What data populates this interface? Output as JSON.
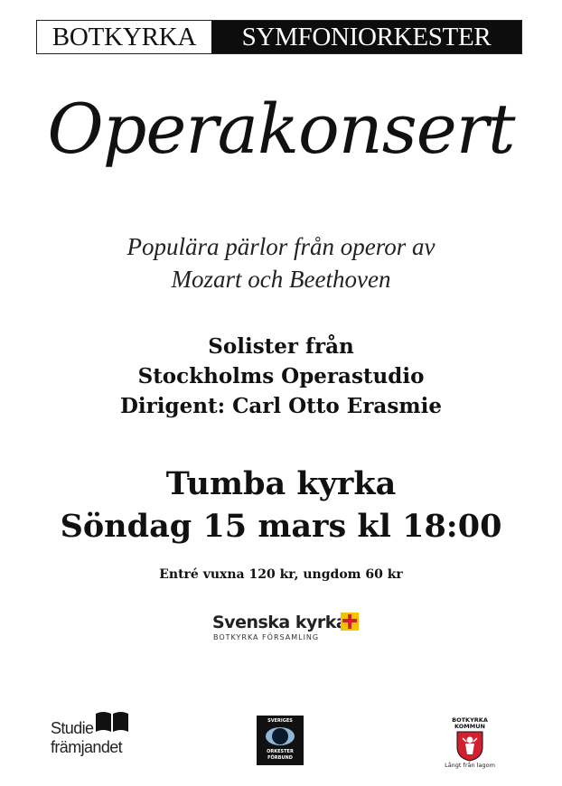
{
  "banner": {
    "left": "BOTKYRKA",
    "right": "SYMFONIORKESTER"
  },
  "title": "Operakonsert",
  "subtitle": [
    "Populära pärlor från operor av",
    "Mozart och Beethoven"
  ],
  "performers": [
    "Solister från",
    "Stockholms Operastudio",
    "Dirigent: Carl Otto Erasmie"
  ],
  "venue": [
    "Tumba kyrka",
    "Söndag 15 mars kl 18:00"
  ],
  "entry": "Entré vuxna 120 kr, ungdom 60 kr",
  "sponsors": {
    "svenska_kyrkan": {
      "name": "Svenska kyrkan",
      "sub": "BOTKYRKA FÖRSAMLING",
      "cross_color": "#f4c300",
      "accent_color": "#d1202f",
      "icon": "church-cross-icon"
    },
    "studiefr": {
      "line1": "Studie",
      "line2": "främjandet",
      "icon": "book-icon"
    },
    "orkester": {
      "top": "SVERIGES",
      "bottom1": "ORKESTER",
      "bottom2": "FÖRBUND",
      "icon": "eye-icon"
    },
    "kommun": {
      "top1": "BOTKYRKA",
      "top2": "KOMMUN",
      "tagline": "Långt från lagom",
      "icon": "crest-shield-icon",
      "shield_color": "#d1202f"
    }
  }
}
